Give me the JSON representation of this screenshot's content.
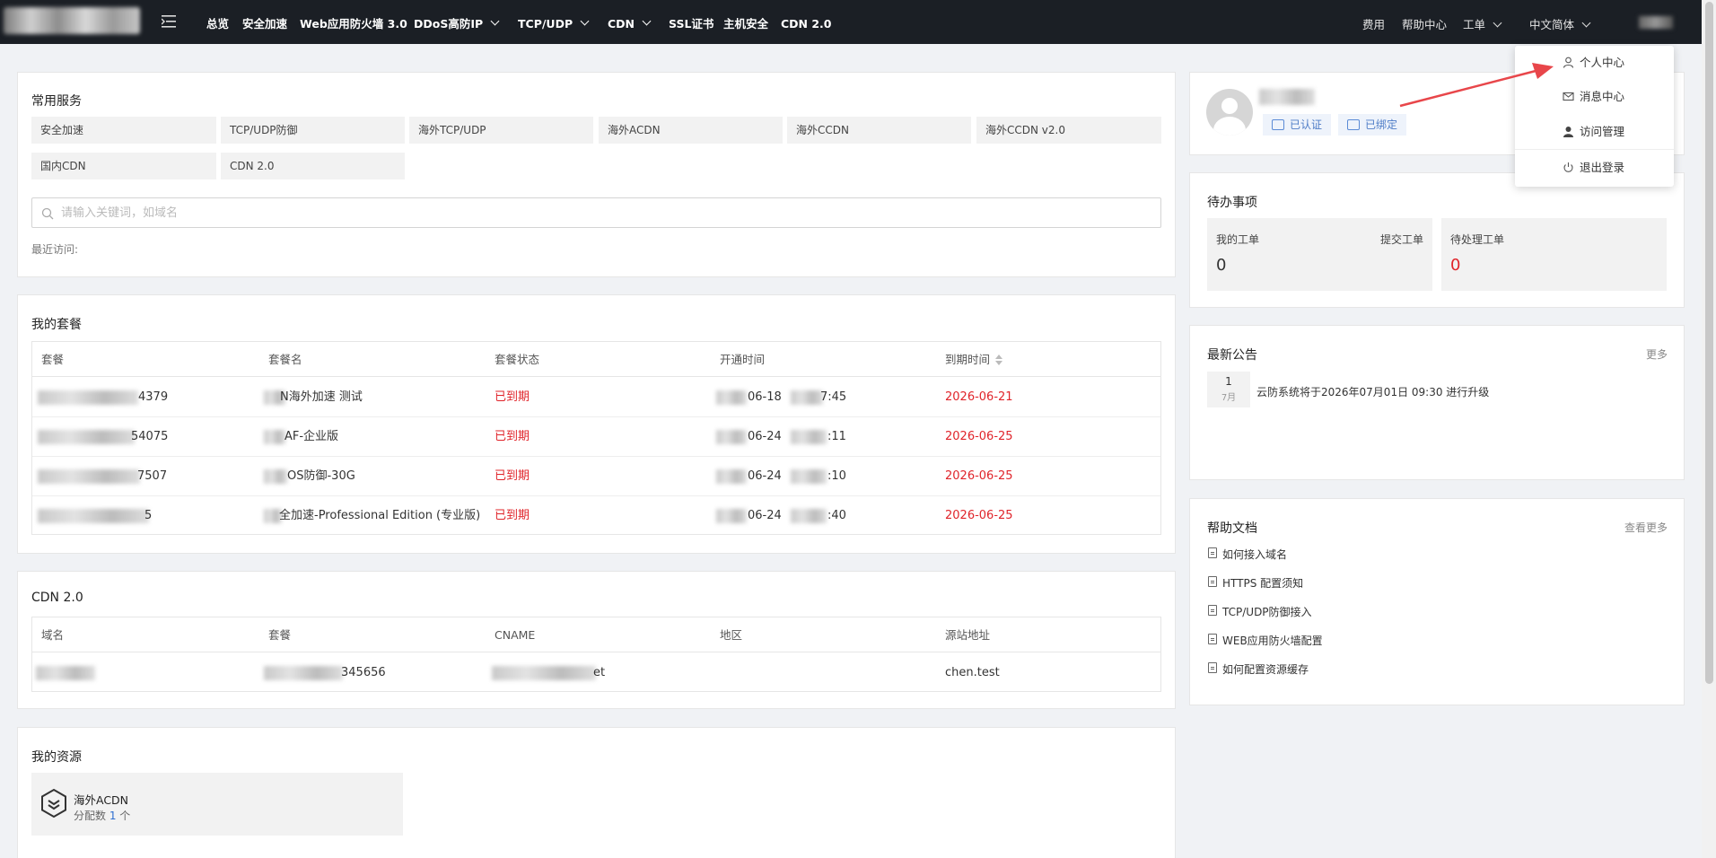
{
  "topnav": {
    "items": [
      "总览",
      "安全加速",
      "Web应用防火墙 3.0",
      "DDoS高防IP",
      "TCP/UDP",
      "CDN",
      "SSL证书",
      "主机安全",
      "CDN 2.0"
    ],
    "right": [
      "费用",
      "帮助中心",
      "工单",
      "中文简体"
    ]
  },
  "services": {
    "title": "常用服务",
    "items": [
      "安全加速",
      "TCP/UDP防御",
      "海外TCP/UDP",
      "海外ACDN",
      "海外CCDN",
      "海外CCDN v2.0",
      "国内CDN",
      "CDN 2.0"
    ],
    "search_placeholder": "请输入关键词，如域名",
    "recent_label": "最近访问:"
  },
  "packages": {
    "title": "我的套餐",
    "headers": [
      "套餐",
      "套餐名",
      "套餐状态",
      "开通时间",
      "到期时间"
    ],
    "rows": [
      {
        "id": "4379",
        "name": "N海外加速 测试",
        "status": "已到期",
        "start_a": "06-18",
        "start_b": "7:45",
        "end": "2026-06-21"
      },
      {
        "id": "54075",
        "name": "AF-企业版",
        "status": "已到期",
        "start_a": "06-24",
        "start_b": ":11",
        "end": "2026-06-25"
      },
      {
        "id": "7507",
        "name": "OS防御-30G",
        "status": "已到期",
        "start_a": "06-24",
        "start_b": ":10",
        "end": "2026-06-25"
      },
      {
        "id": "5",
        "name": "全加速-Professional Edition (专业版)",
        "status": "已到期",
        "start_a": "06-24",
        "start_b": ":40",
        "end": "2026-06-25"
      }
    ]
  },
  "cdn2": {
    "title": "CDN 2.0",
    "headers": [
      "域名",
      "套餐",
      "CNAME",
      "地区",
      "源站地址"
    ],
    "rows": [
      {
        "pkg": "345656",
        "cname": "et",
        "region": "",
        "origin": "chen.test"
      }
    ]
  },
  "resources": {
    "title": "我的资源",
    "item_name": "海外ACDN",
    "item_sub_prefix": "分配数 ",
    "item_count": "1",
    "item_sub_suffix": " 个"
  },
  "profile": {
    "verified": "已认证",
    "bound": "已绑定"
  },
  "todo": {
    "title": "待办事项",
    "my_tickets_label": "我的工单",
    "submit_label": "提交工单",
    "my_tickets_count": "0",
    "pending_label": "待处理工单",
    "pending_count": "0"
  },
  "notices": {
    "title": "最新公告",
    "more": "更多",
    "items": [
      {
        "day": "1",
        "month": "7月",
        "text": "云防系统将于2026年07月01日 09:30 进行升级"
      }
    ]
  },
  "docs": {
    "title": "帮助文档",
    "more": "查看更多",
    "items": [
      "如何接入域名",
      "HTTPS 配置须知",
      "TCP/UDP防御接入",
      "WEB应用防火墙配置",
      "如何配置资源缓存"
    ]
  },
  "dropdown": {
    "items": [
      "个人中心",
      "消息中心",
      "访问管理",
      "退出登录"
    ]
  },
  "colors": {
    "accent_red": "#e0242a",
    "topbar": "#1b1f25",
    "link_blue": "#4f7dc7",
    "arrow": "#e8464a"
  }
}
